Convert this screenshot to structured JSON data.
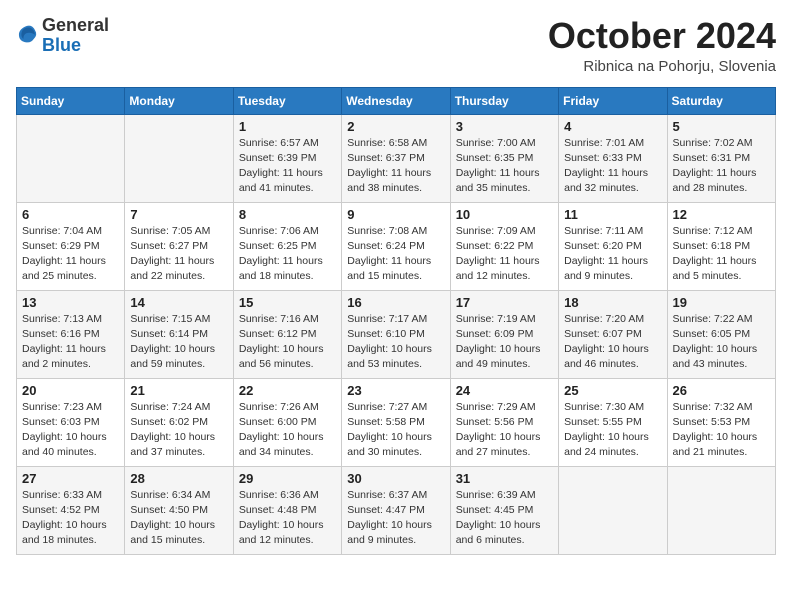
{
  "header": {
    "logo_general": "General",
    "logo_blue": "Blue",
    "month_title": "October 2024",
    "location": "Ribnica na Pohorju, Slovenia"
  },
  "days_of_week": [
    "Sunday",
    "Monday",
    "Tuesday",
    "Wednesday",
    "Thursday",
    "Friday",
    "Saturday"
  ],
  "weeks": [
    [
      {
        "day": "",
        "sunrise": "",
        "sunset": "",
        "daylight": ""
      },
      {
        "day": "",
        "sunrise": "",
        "sunset": "",
        "daylight": ""
      },
      {
        "day": "1",
        "sunrise": "Sunrise: 6:57 AM",
        "sunset": "Sunset: 6:39 PM",
        "daylight": "Daylight: 11 hours and 41 minutes."
      },
      {
        "day": "2",
        "sunrise": "Sunrise: 6:58 AM",
        "sunset": "Sunset: 6:37 PM",
        "daylight": "Daylight: 11 hours and 38 minutes."
      },
      {
        "day": "3",
        "sunrise": "Sunrise: 7:00 AM",
        "sunset": "Sunset: 6:35 PM",
        "daylight": "Daylight: 11 hours and 35 minutes."
      },
      {
        "day": "4",
        "sunrise": "Sunrise: 7:01 AM",
        "sunset": "Sunset: 6:33 PM",
        "daylight": "Daylight: 11 hours and 32 minutes."
      },
      {
        "day": "5",
        "sunrise": "Sunrise: 7:02 AM",
        "sunset": "Sunset: 6:31 PM",
        "daylight": "Daylight: 11 hours and 28 minutes."
      }
    ],
    [
      {
        "day": "6",
        "sunrise": "Sunrise: 7:04 AM",
        "sunset": "Sunset: 6:29 PM",
        "daylight": "Daylight: 11 hours and 25 minutes."
      },
      {
        "day": "7",
        "sunrise": "Sunrise: 7:05 AM",
        "sunset": "Sunset: 6:27 PM",
        "daylight": "Daylight: 11 hours and 22 minutes."
      },
      {
        "day": "8",
        "sunrise": "Sunrise: 7:06 AM",
        "sunset": "Sunset: 6:25 PM",
        "daylight": "Daylight: 11 hours and 18 minutes."
      },
      {
        "day": "9",
        "sunrise": "Sunrise: 7:08 AM",
        "sunset": "Sunset: 6:24 PM",
        "daylight": "Daylight: 11 hours and 15 minutes."
      },
      {
        "day": "10",
        "sunrise": "Sunrise: 7:09 AM",
        "sunset": "Sunset: 6:22 PM",
        "daylight": "Daylight: 11 hours and 12 minutes."
      },
      {
        "day": "11",
        "sunrise": "Sunrise: 7:11 AM",
        "sunset": "Sunset: 6:20 PM",
        "daylight": "Daylight: 11 hours and 9 minutes."
      },
      {
        "day": "12",
        "sunrise": "Sunrise: 7:12 AM",
        "sunset": "Sunset: 6:18 PM",
        "daylight": "Daylight: 11 hours and 5 minutes."
      }
    ],
    [
      {
        "day": "13",
        "sunrise": "Sunrise: 7:13 AM",
        "sunset": "Sunset: 6:16 PM",
        "daylight": "Daylight: 11 hours and 2 minutes."
      },
      {
        "day": "14",
        "sunrise": "Sunrise: 7:15 AM",
        "sunset": "Sunset: 6:14 PM",
        "daylight": "Daylight: 10 hours and 59 minutes."
      },
      {
        "day": "15",
        "sunrise": "Sunrise: 7:16 AM",
        "sunset": "Sunset: 6:12 PM",
        "daylight": "Daylight: 10 hours and 56 minutes."
      },
      {
        "day": "16",
        "sunrise": "Sunrise: 7:17 AM",
        "sunset": "Sunset: 6:10 PM",
        "daylight": "Daylight: 10 hours and 53 minutes."
      },
      {
        "day": "17",
        "sunrise": "Sunrise: 7:19 AM",
        "sunset": "Sunset: 6:09 PM",
        "daylight": "Daylight: 10 hours and 49 minutes."
      },
      {
        "day": "18",
        "sunrise": "Sunrise: 7:20 AM",
        "sunset": "Sunset: 6:07 PM",
        "daylight": "Daylight: 10 hours and 46 minutes."
      },
      {
        "day": "19",
        "sunrise": "Sunrise: 7:22 AM",
        "sunset": "Sunset: 6:05 PM",
        "daylight": "Daylight: 10 hours and 43 minutes."
      }
    ],
    [
      {
        "day": "20",
        "sunrise": "Sunrise: 7:23 AM",
        "sunset": "Sunset: 6:03 PM",
        "daylight": "Daylight: 10 hours and 40 minutes."
      },
      {
        "day": "21",
        "sunrise": "Sunrise: 7:24 AM",
        "sunset": "Sunset: 6:02 PM",
        "daylight": "Daylight: 10 hours and 37 minutes."
      },
      {
        "day": "22",
        "sunrise": "Sunrise: 7:26 AM",
        "sunset": "Sunset: 6:00 PM",
        "daylight": "Daylight: 10 hours and 34 minutes."
      },
      {
        "day": "23",
        "sunrise": "Sunrise: 7:27 AM",
        "sunset": "Sunset: 5:58 PM",
        "daylight": "Daylight: 10 hours and 30 minutes."
      },
      {
        "day": "24",
        "sunrise": "Sunrise: 7:29 AM",
        "sunset": "Sunset: 5:56 PM",
        "daylight": "Daylight: 10 hours and 27 minutes."
      },
      {
        "day": "25",
        "sunrise": "Sunrise: 7:30 AM",
        "sunset": "Sunset: 5:55 PM",
        "daylight": "Daylight: 10 hours and 24 minutes."
      },
      {
        "day": "26",
        "sunrise": "Sunrise: 7:32 AM",
        "sunset": "Sunset: 5:53 PM",
        "daylight": "Daylight: 10 hours and 21 minutes."
      }
    ],
    [
      {
        "day": "27",
        "sunrise": "Sunrise: 6:33 AM",
        "sunset": "Sunset: 4:52 PM",
        "daylight": "Daylight: 10 hours and 18 minutes."
      },
      {
        "day": "28",
        "sunrise": "Sunrise: 6:34 AM",
        "sunset": "Sunset: 4:50 PM",
        "daylight": "Daylight: 10 hours and 15 minutes."
      },
      {
        "day": "29",
        "sunrise": "Sunrise: 6:36 AM",
        "sunset": "Sunset: 4:48 PM",
        "daylight": "Daylight: 10 hours and 12 minutes."
      },
      {
        "day": "30",
        "sunrise": "Sunrise: 6:37 AM",
        "sunset": "Sunset: 4:47 PM",
        "daylight": "Daylight: 10 hours and 9 minutes."
      },
      {
        "day": "31",
        "sunrise": "Sunrise: 6:39 AM",
        "sunset": "Sunset: 4:45 PM",
        "daylight": "Daylight: 10 hours and 6 minutes."
      },
      {
        "day": "",
        "sunrise": "",
        "sunset": "",
        "daylight": ""
      },
      {
        "day": "",
        "sunrise": "",
        "sunset": "",
        "daylight": ""
      }
    ]
  ]
}
